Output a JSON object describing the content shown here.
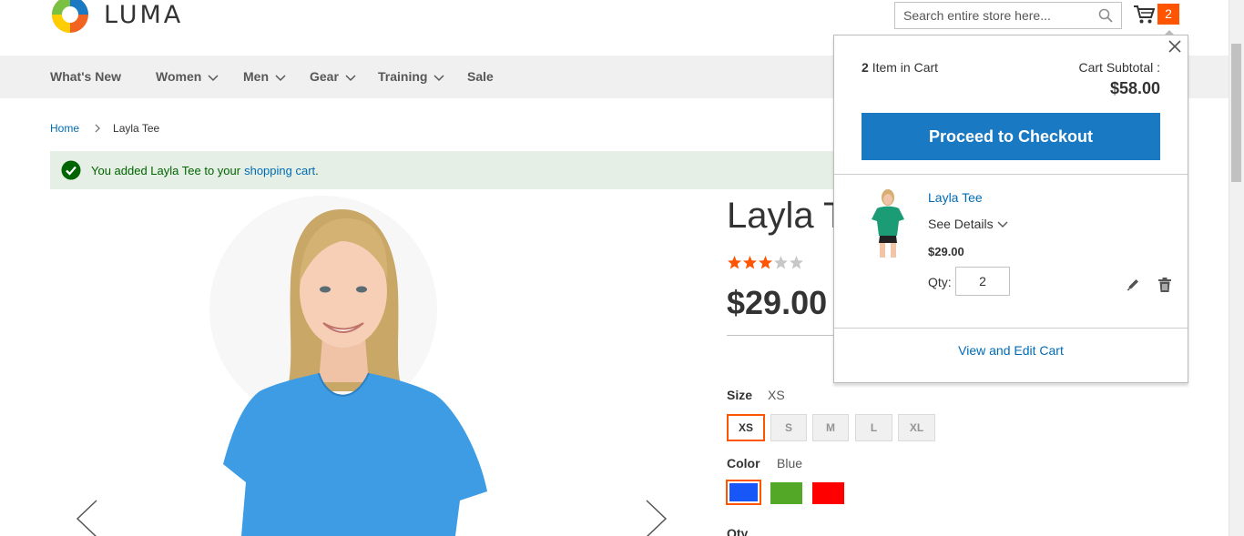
{
  "header": {
    "logo_text": "LUMA",
    "search_placeholder": "Search entire store here...",
    "cart_count": "2"
  },
  "nav": {
    "items": [
      {
        "label": "What's New",
        "has_submenu": false
      },
      {
        "label": "Women",
        "has_submenu": true
      },
      {
        "label": "Men",
        "has_submenu": true
      },
      {
        "label": "Gear",
        "has_submenu": true
      },
      {
        "label": "Training",
        "has_submenu": true
      },
      {
        "label": "Sale",
        "has_submenu": false
      }
    ]
  },
  "breadcrumb": {
    "home": "Home",
    "current": "Layla Tee"
  },
  "message": {
    "text": "You added Layla Tee to your",
    "link": "shopping cart",
    "suffix": "."
  },
  "product": {
    "title": "Layla Tee",
    "rating_stars": 3,
    "rating_max": 5,
    "price": "$29.00",
    "size_label": "Size",
    "size_value": "XS",
    "sizes": [
      "XS",
      "S",
      "M",
      "L",
      "XL"
    ],
    "color_label": "Color",
    "color_value": "Blue",
    "colors": [
      {
        "name": "Blue",
        "hex": "#1857f7"
      },
      {
        "name": "Green",
        "hex": "#53a828"
      },
      {
        "name": "Red",
        "hex": "#ff0000"
      }
    ],
    "qty_label": "Qty"
  },
  "minicart": {
    "count": "2",
    "count_suffix": "Item in Cart",
    "subtotal_label": "Cart Subtotal :",
    "subtotal": "$58.00",
    "checkout_label": "Proceed to Checkout",
    "item": {
      "name": "Layla Tee",
      "details_label": "See Details",
      "price": "$29.00",
      "qty_label": "Qty:",
      "qty_value": "2"
    },
    "view_cart_label": "View and Edit Cart"
  },
  "colors": {
    "accent": "#ff5501",
    "primary_button": "#1979c3",
    "link": "#006bb4",
    "success_bg": "#e5efe5",
    "success_text": "#006400"
  }
}
